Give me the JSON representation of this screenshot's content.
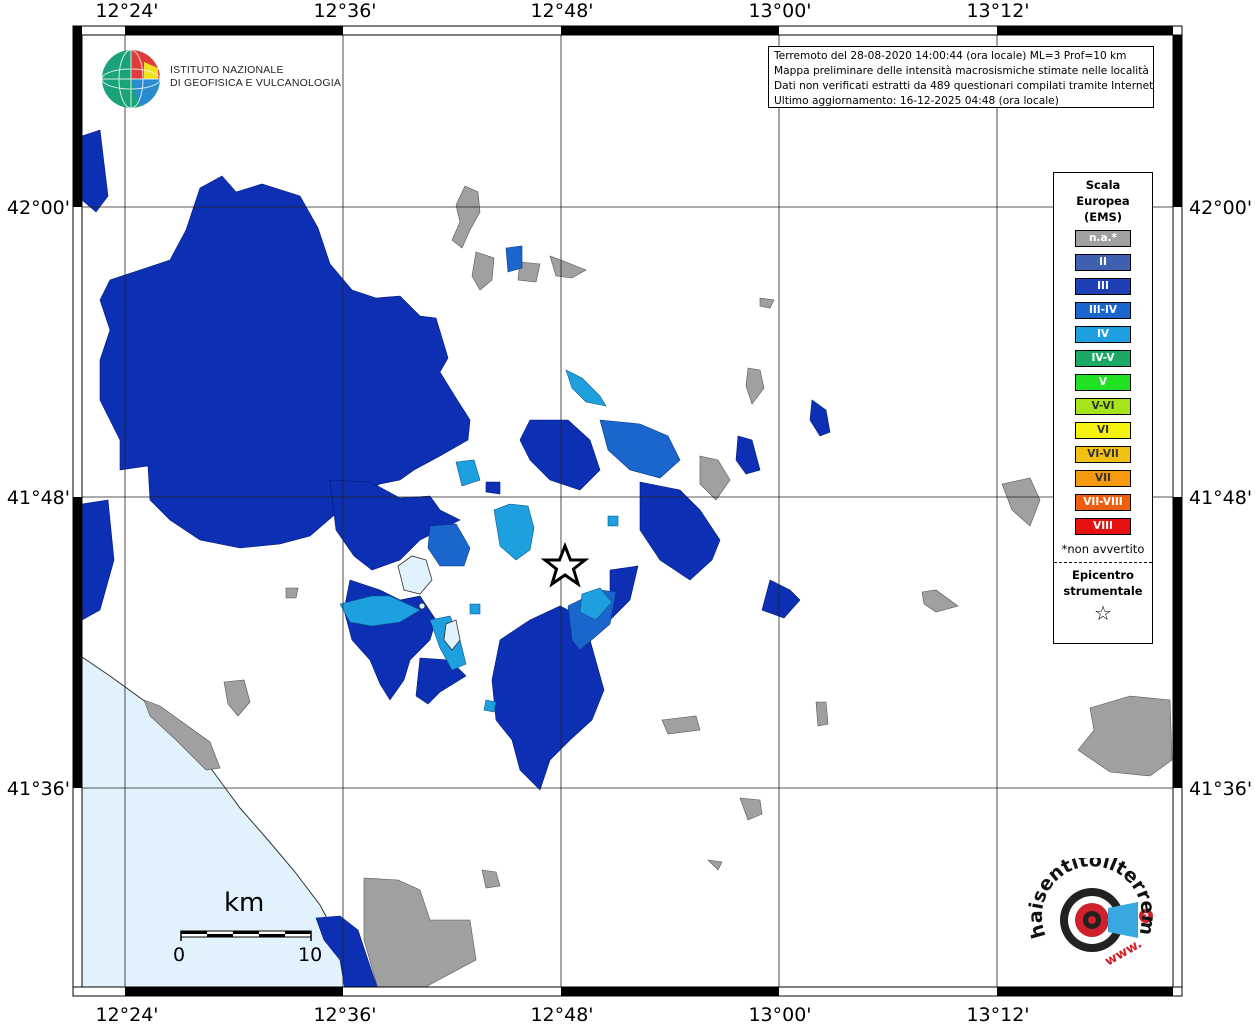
{
  "info": {
    "line1": "Terremoto del 28-08-2020 14:00:44 (ora locale) ML=3 Prof=10 km",
    "line2": "Mappa preliminare delle intensità macrosismiche stimate nelle località",
    "line3": "Dati non verificati estratti da 489 questionari compilati tramite Internet.",
    "line4": "Ultimo aggiornamento: 16-12-2025 04:48 (ora locale)"
  },
  "logo": {
    "line1": "ISTITUTO NAZIONALE",
    "line2": "DI GEOFISICA E VULCANOLOGIA",
    "hsit": "haisentitoilterremoto.it",
    "hsit_www": "www."
  },
  "axes": {
    "top": [
      "12°24'",
      "12°36'",
      "12°48'",
      "13°00'",
      "13°12'"
    ],
    "bottom": [
      "12°24'",
      "12°36'",
      "12°48'",
      "13°00'",
      "13°12'"
    ],
    "left": [
      "42°00'",
      "41°48'",
      "41°36'"
    ],
    "right": [
      "42°00'",
      "41°48'",
      "41°36'"
    ]
  },
  "legend": {
    "title": [
      "Scala",
      "Europea",
      "(EMS)"
    ],
    "classes": [
      {
        "label": "n.a.*",
        "color": "#a0a0a0"
      },
      {
        "label": "II",
        "color": "#3f5fb0"
      },
      {
        "label": "III",
        "color": "#1f3fb7"
      },
      {
        "label": "III-IV",
        "color": "#1a66cc"
      },
      {
        "label": "IV",
        "color": "#1e9fe0"
      },
      {
        "label": "IV-V",
        "color": "#1aaa66"
      },
      {
        "label": "V",
        "color": "#22e022"
      },
      {
        "label": "V-VI",
        "color": "#a8e41c"
      },
      {
        "label": "VI",
        "color": "#f5f20f"
      },
      {
        "label": "VI-VII",
        "color": "#f3c114"
      },
      {
        "label": "VII",
        "color": "#f59a10"
      },
      {
        "label": "VII-VIII",
        "color": "#ee6010"
      },
      {
        "label": "VIII",
        "color": "#e61010"
      }
    ],
    "note": "*non avvertito",
    "epicenter": [
      "Epicentro",
      "strumentale"
    ]
  },
  "scale": {
    "unit": "km",
    "min": "0",
    "max": "10"
  },
  "colors": {
    "sea": "#e2f2fc",
    "intensity_III": "#0c2fb3",
    "intensity_III_IV": "#1a66cc",
    "intensity_IV": "#1e9fe0",
    "not_available": "#a0a0a0"
  }
}
